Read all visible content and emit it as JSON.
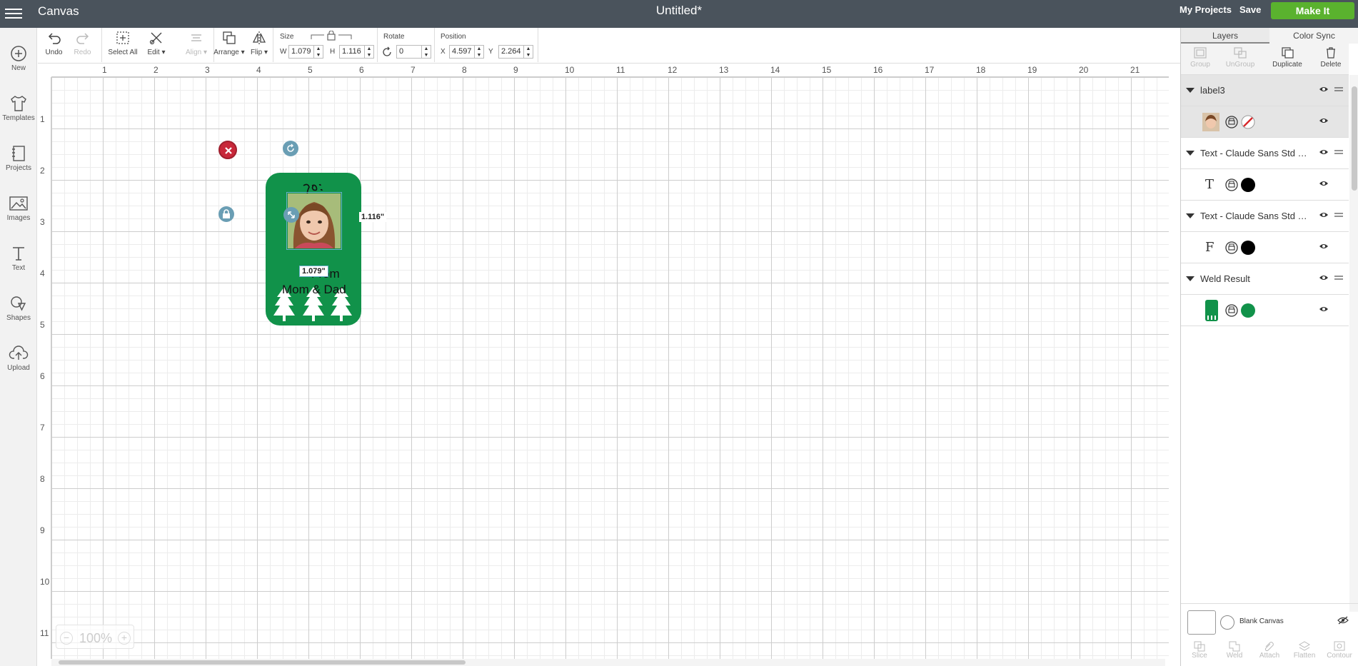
{
  "app": {
    "name": "Canvas",
    "document_title": "Untitled*"
  },
  "header": {
    "my_projects": "My Projects",
    "save": "Save",
    "make_it": "Make It",
    "make_it_color": "#5ab22e"
  },
  "sidebar": {
    "items": [
      {
        "label": "New",
        "icon": "plus-circle-icon"
      },
      {
        "label": "Templates",
        "icon": "shirt-icon"
      },
      {
        "label": "Projects",
        "icon": "projects-icon"
      },
      {
        "label": "Images",
        "icon": "image-icon"
      },
      {
        "label": "Text",
        "icon": "text-icon"
      },
      {
        "label": "Shapes",
        "icon": "shapes-icon"
      },
      {
        "label": "Upload",
        "icon": "upload-icon"
      }
    ]
  },
  "toolbar": {
    "undo": "Undo",
    "redo": "Redo",
    "select_all": "Select All",
    "edit": "Edit",
    "align": "Align",
    "arrange": "Arrange",
    "flip": "Flip",
    "size_label": "Size",
    "w_label": "W",
    "h_label": "H",
    "width": "1.079",
    "height": "1.116",
    "rotate_label": "Rotate",
    "rotate": "0",
    "position_label": "Position",
    "x_label": "X",
    "y_label": "Y",
    "x": "4.597",
    "y": "2.264"
  },
  "canvas": {
    "ruler_top": [
      "1",
      "2",
      "3",
      "4",
      "5",
      "6",
      "7",
      "8",
      "9",
      "10",
      "11",
      "12",
      "13",
      "14",
      "15",
      "16",
      "17",
      "18",
      "19",
      "20",
      "21"
    ],
    "ruler_left": [
      "1",
      "2",
      "3",
      "4",
      "5",
      "6",
      "7",
      "8",
      "9",
      "10",
      "11"
    ],
    "card_text_line1": "From",
    "card_text_line2": "Mom & Dad",
    "height_label": "1.116\"",
    "width_label": "1.079\"",
    "zoom": "100%",
    "zoom_minus": "−",
    "zoom_plus": "+",
    "card_color": "#11924a"
  },
  "panel": {
    "tabs": [
      "Layers",
      "Color Sync"
    ],
    "actions": [
      "Group",
      "UnGroup",
      "Duplicate",
      "Delete"
    ],
    "layers": [
      {
        "name": "label3",
        "child_color": "none"
      },
      {
        "name": "Text - Claude Sans Std Regular",
        "glyph": "T",
        "child_color": "#000000"
      },
      {
        "name": "Text - Claude Sans Std Regular",
        "glyph": "F",
        "child_color": "#000000"
      },
      {
        "name": "Weld Result",
        "child_color": "#11924a"
      }
    ],
    "blank_canvas": "Blank Canvas",
    "bottom_actions": [
      "Slice",
      "Weld",
      "Attach",
      "Flatten",
      "Contour"
    ]
  }
}
